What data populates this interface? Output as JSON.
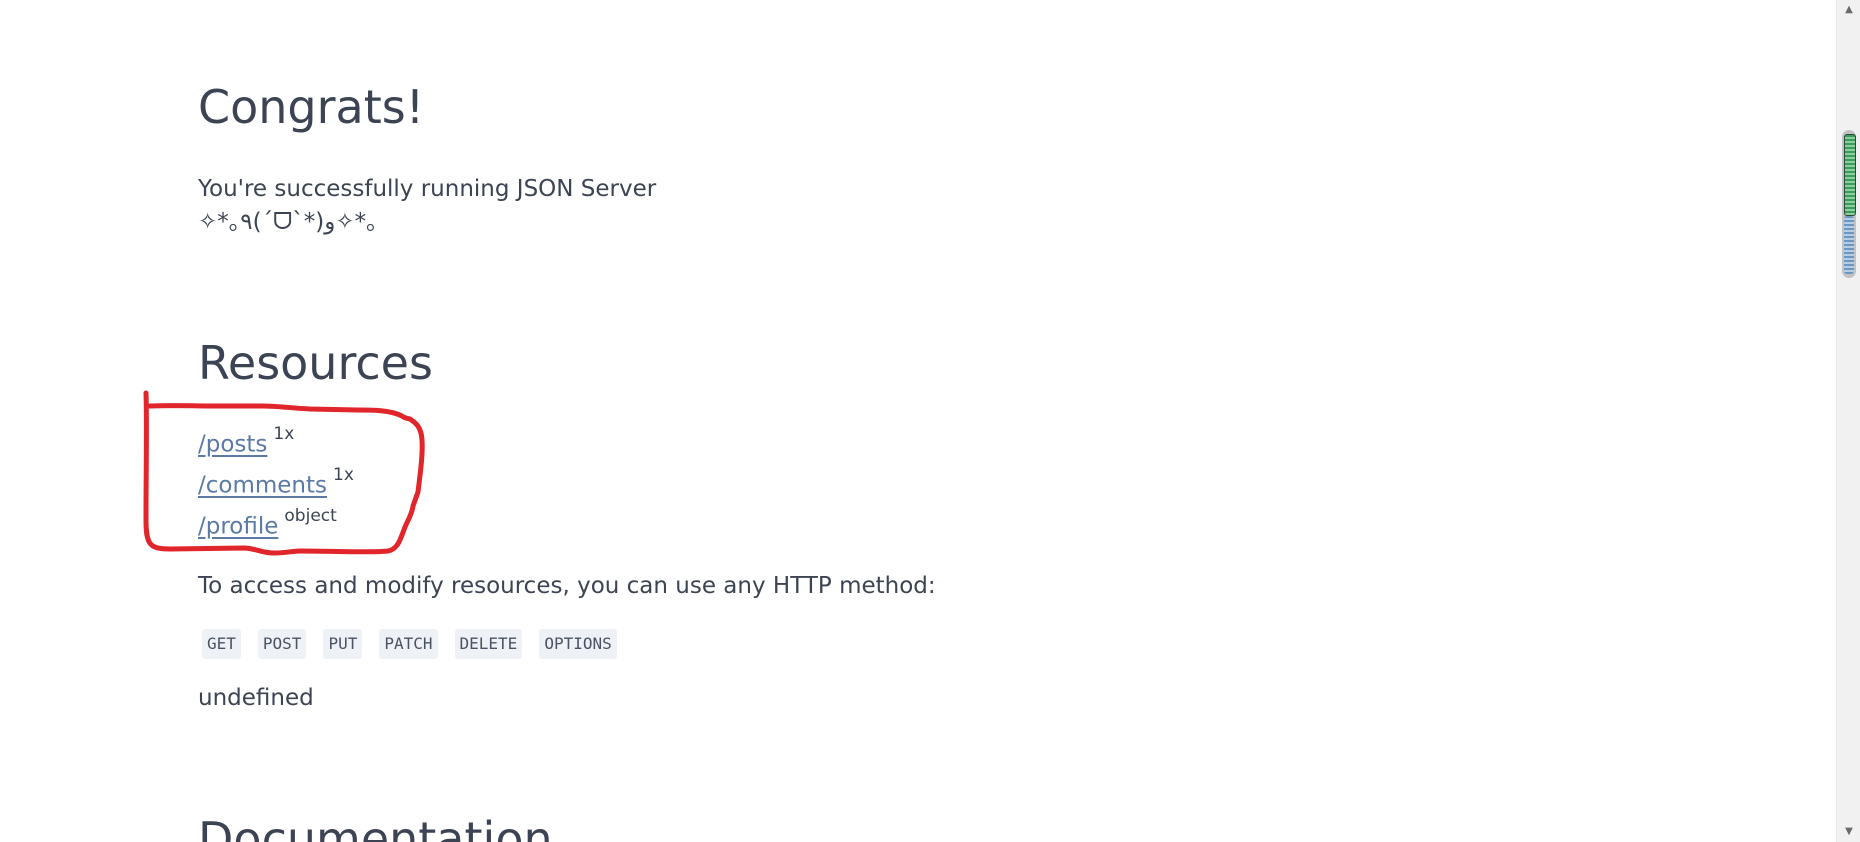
{
  "intro": {
    "heading": "Congrats!",
    "tagline": "You're successfully running JSON Server",
    "kaomoji": "✧*｡٩(ˊᗜˋ*)و✧*｡"
  },
  "resources": {
    "heading": "Resources",
    "items": [
      {
        "path": "/posts",
        "badge": "1x"
      },
      {
        "path": "/comments",
        "badge": "1x"
      },
      {
        "path": "/profile",
        "badge": "object"
      }
    ],
    "access_text": "To access and modify resources, you can use any HTTP method:",
    "methods": [
      "GET",
      "POST",
      "PUT",
      "PATCH",
      "DELETE",
      "OPTIONS"
    ],
    "footer_text": "undefined"
  },
  "documentation": {
    "heading": "Documentation"
  },
  "annotation": {
    "color": "#e0252b",
    "shape": "freehand-loop"
  },
  "scrollbar": {
    "up_icon": "scroll-up-arrow-icon",
    "down_icon": "scroll-down-arrow-icon"
  }
}
